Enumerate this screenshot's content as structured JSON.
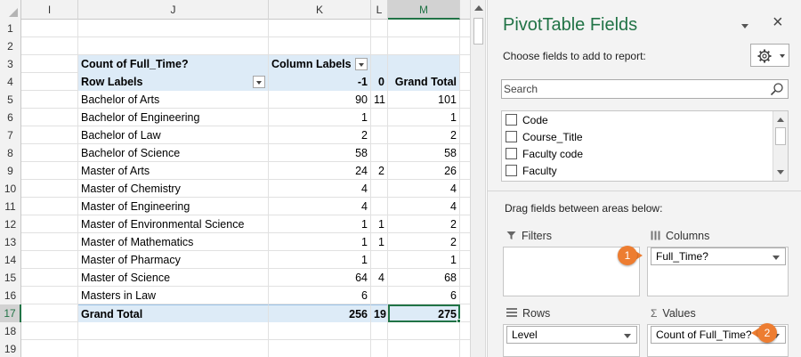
{
  "sheet": {
    "columns": [
      "I",
      "J",
      "K",
      "L",
      "M"
    ],
    "row_numbers": [
      "1",
      "2",
      "3",
      "4",
      "5",
      "6",
      "7",
      "8",
      "9",
      "10",
      "11",
      "12",
      "13",
      "14",
      "15",
      "16",
      "17",
      "18",
      "19"
    ],
    "pivot": {
      "header_value": "Count of Full_Time?",
      "column_labels": "Column Labels",
      "row_labels": "Row Labels",
      "col_headers": [
        "-1",
        "0",
        "Grand Total"
      ],
      "rows": [
        {
          "label": "Bachelor of Arts",
          "v1": "90",
          "v0": "11",
          "total": "101"
        },
        {
          "label": "Bachelor of Engineering",
          "v1": "1",
          "v0": "",
          "total": "1"
        },
        {
          "label": "Bachelor of Law",
          "v1": "2",
          "v0": "",
          "total": "2"
        },
        {
          "label": "Bachelor of Science",
          "v1": "58",
          "v0": "",
          "total": "58"
        },
        {
          "label": "Master of Arts",
          "v1": "24",
          "v0": "2",
          "total": "26"
        },
        {
          "label": "Master of Chemistry",
          "v1": "4",
          "v0": "",
          "total": "4"
        },
        {
          "label": "Master of Engineering",
          "v1": "4",
          "v0": "",
          "total": "4"
        },
        {
          "label": "Master of Environmental Science",
          "v1": "1",
          "v0": "1",
          "total": "2"
        },
        {
          "label": "Master of Mathematics",
          "v1": "1",
          "v0": "1",
          "total": "2"
        },
        {
          "label": "Master of Pharmacy",
          "v1": "1",
          "v0": "",
          "total": "1"
        },
        {
          "label": "Master of Science",
          "v1": "64",
          "v0": "4",
          "total": "68"
        },
        {
          "label": "Masters in Law",
          "v1": "6",
          "v0": "",
          "total": "6"
        }
      ],
      "grand_total": {
        "label": "Grand Total",
        "v1": "256",
        "v0": "19",
        "total": "275"
      }
    }
  },
  "pane": {
    "title": "PivotTable Fields",
    "close_glyph": "×",
    "choose_label": "Choose fields to add to report:",
    "search_placeholder": "Search",
    "fields": [
      "Code",
      "Course_Title",
      "Faculty code",
      "Faculty"
    ],
    "drag_label": "Drag fields between areas below:",
    "areas": {
      "filters": {
        "title": "Filters",
        "icon": "filter-icon"
      },
      "columns": {
        "title": "Columns",
        "icon": "columns-icon",
        "chip": "Full_Time?"
      },
      "rows": {
        "title": "Rows",
        "icon": "rows-icon",
        "chip": "Level"
      },
      "values": {
        "title": "Values",
        "icon": "sigma-icon",
        "glyph": "Σ",
        "chip": "Count of Full_Time?"
      }
    },
    "callouts": [
      "1",
      "2"
    ]
  },
  "colors": {
    "accent": "#217346",
    "pivot_header": "#ddebf7",
    "callout": "#ed7d31"
  }
}
